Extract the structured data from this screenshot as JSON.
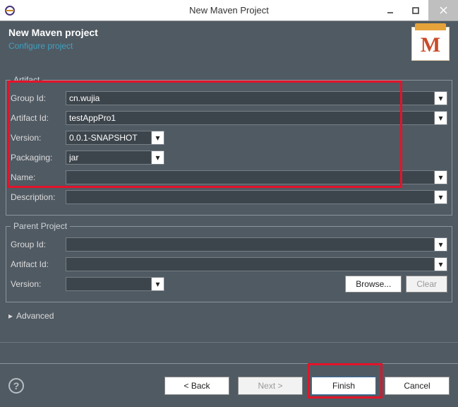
{
  "window": {
    "title": "New Maven Project"
  },
  "header": {
    "title": "New Maven project",
    "subtitle": "Configure project",
    "icon_letter": "M"
  },
  "artifact": {
    "legend": "Artifact",
    "groupId_label": "Group Id:",
    "groupId": "cn.wujia",
    "artifactId_label": "Artifact Id:",
    "artifactId": "testAppPro1",
    "version_label": "Version:",
    "version": "0.0.1-SNAPSHOT",
    "packaging_label": "Packaging:",
    "packaging": "jar",
    "name_label": "Name:",
    "name": "",
    "desc_label": "Description:",
    "desc": ""
  },
  "parent": {
    "legend": "Parent Project",
    "groupId_label": "Group Id:",
    "groupId": "",
    "artifactId_label": "Artifact Id:",
    "artifactId": "",
    "version_label": "Version:",
    "version": "",
    "browse": "Browse...",
    "clear": "Clear"
  },
  "advanced_label": "Advanced",
  "buttons": {
    "back": "< Back",
    "next": "Next >",
    "finish": "Finish",
    "cancel": "Cancel"
  }
}
